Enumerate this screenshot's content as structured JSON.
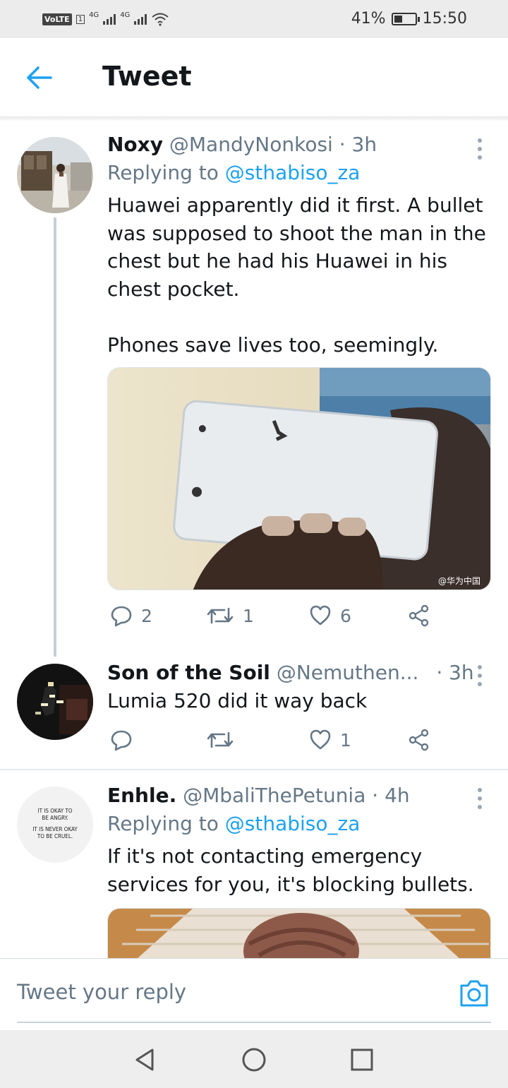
{
  "status_bar": {
    "volte": "VoLTE",
    "sim": "1",
    "network1": "4G",
    "network2": "4G",
    "battery_percent": "41%",
    "battery_level": 0.41,
    "time": "15:50"
  },
  "header": {
    "title": "Tweet",
    "back_icon": "arrow-left-icon"
  },
  "tweets": [
    {
      "name": "Noxy",
      "handle": "@MandyNonkosi",
      "time": "· 3h",
      "replying_prefix": "Replying to",
      "replying_to": "@sthabiso_za",
      "text_lines": [
        "Huawei apparently did it first. A bullet",
        "was supposed to shoot the man in the",
        "chest but he had his Huawei in his",
        "chest pocket.",
        "",
        "Phones save lives too, seemingly."
      ],
      "image_watermark": "@华为中国",
      "reply_count": "2",
      "retweet_count": "1",
      "like_count": "6"
    },
    {
      "name": "Son of the Soil",
      "handle": "@Nemuthen...",
      "time": "· 3h",
      "text": "Lumia 520 did it way back",
      "reply_count": "",
      "retweet_count": "",
      "like_count": "1"
    },
    {
      "name": "Enhle.",
      "handle": "@MbaliThePetunia",
      "time": "· 4h",
      "replying_prefix": "Replying to",
      "replying_to": "@sthabiso_za",
      "text_lines": [
        "If it's not contacting emergency",
        "services for you, it's blocking bullets."
      ],
      "avatar_text": [
        "IT IS OKAY TO",
        "BE ANGRY.",
        "IT IS NEVER OKAY",
        "TO BE CRUEL."
      ]
    }
  ],
  "composer": {
    "placeholder": "Tweet your reply",
    "camera_icon": "camera-icon"
  },
  "nav": {
    "back": "triangle-back-icon",
    "home": "circle-home-icon",
    "recents": "square-recents-icon"
  }
}
